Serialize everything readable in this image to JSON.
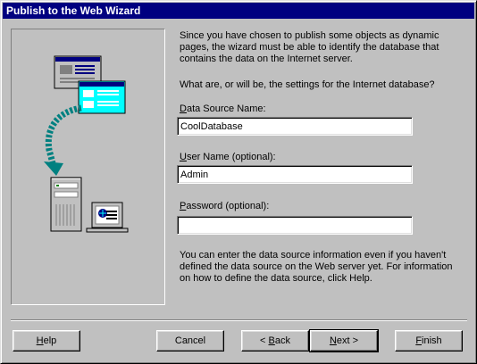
{
  "window": {
    "title": "Publish to the Web Wizard"
  },
  "intro": {
    "paragraph": "Since you have chosen to publish some objects as dynamic pages, the wizard must be able to identify the database that contains the data on the Internet server.",
    "question": "What are, or will be, the settings for the Internet database?"
  },
  "fields": {
    "dsn": {
      "label_key": "D",
      "label_rest": "ata Source Name:",
      "value": "CoolDatabase"
    },
    "user": {
      "label_key": "U",
      "label_rest": "ser Name (optional):",
      "value": "Admin"
    },
    "password": {
      "label_key": "P",
      "label_rest": "assword (optional):",
      "value": ""
    }
  },
  "footer_note": "You can enter the data source information even if you haven't defined the data source on the Web server yet. For information on how to define the data source, click Help.",
  "buttons": {
    "help": {
      "key": "H",
      "rest": "elp"
    },
    "cancel": {
      "label": "Cancel"
    },
    "back": {
      "prefix": "< ",
      "key": "B",
      "rest": "ack"
    },
    "next": {
      "key": "N",
      "rest": "ext >"
    },
    "finish": {
      "key": "F",
      "rest": "inish"
    }
  },
  "colors": {
    "title_bar": "#000080",
    "window_face": "#c0c0c0",
    "document_cyan": "#00ffff",
    "arrow_teal": "#008080"
  },
  "icons": [
    "web-page-document-icon",
    "curved-arrow-icon",
    "server-computer-icon",
    "web-monitor-icon"
  ]
}
